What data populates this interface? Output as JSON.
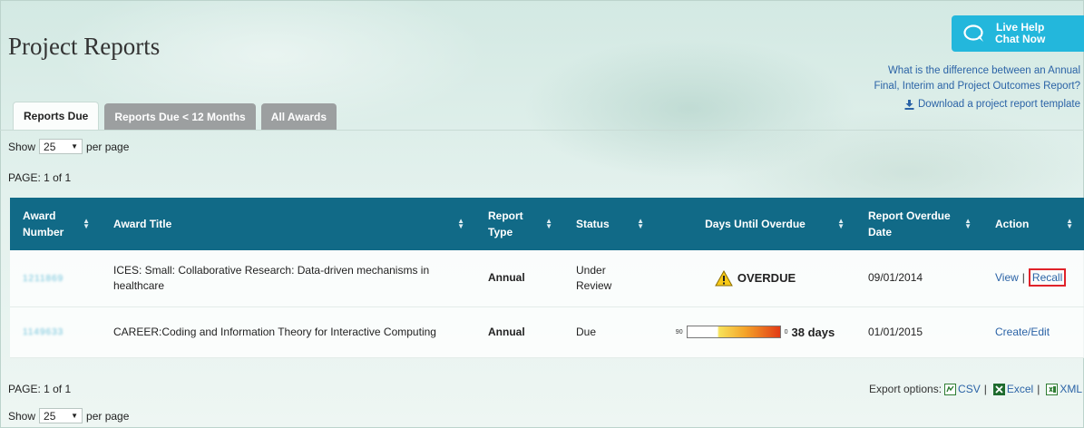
{
  "page": {
    "title": "Project Reports"
  },
  "live_help": {
    "line1": "Live Help",
    "line2": "Chat Now",
    "icon": "chat-bubble-icon",
    "color": "#23b7dc"
  },
  "help": {
    "question_line1": "What is the difference between an Annual",
    "question_line2": "Final, Interim and Project Outcomes Report?",
    "download": "Download a project report template"
  },
  "tabs": [
    {
      "label": "Reports Due",
      "active": true
    },
    {
      "label": "Reports Due < 12 Months",
      "active": false
    },
    {
      "label": "All Awards",
      "active": false
    }
  ],
  "pager": {
    "show_label": "Show",
    "per_page_value": "25",
    "per_page_label": "per page",
    "page_text": "PAGE: 1 of 1"
  },
  "table": {
    "header_color": "#116a87",
    "columns": [
      "Award Number",
      "Award Title",
      "Report Type",
      "Status",
      "Days Until Overdue",
      "Report Overdue Date",
      "Action"
    ],
    "rows": [
      {
        "award_number": "1211869",
        "title": "ICES: Small: Collaborative Research: Data-driven mechanisms in healthcare",
        "report_type": "Annual",
        "status": "Under Review",
        "days_until_overdue": "OVERDUE",
        "overdue_date": "09/01/2014",
        "actions": [
          "View",
          "Recall"
        ]
      },
      {
        "award_number": "1149633",
        "title": "CAREER:Coding and Information Theory for Interactive Computing",
        "report_type": "Annual",
        "status": "Due",
        "meter": {
          "left": "90",
          "right": "0",
          "fraction_remaining": 0.42
        },
        "days_until_overdue": "38 days",
        "overdue_date": "01/01/2015",
        "actions": [
          "Create/Edit"
        ]
      }
    ]
  },
  "export": {
    "label": "Export options:",
    "csv": "CSV",
    "excel": "Excel",
    "xml": "XML"
  }
}
